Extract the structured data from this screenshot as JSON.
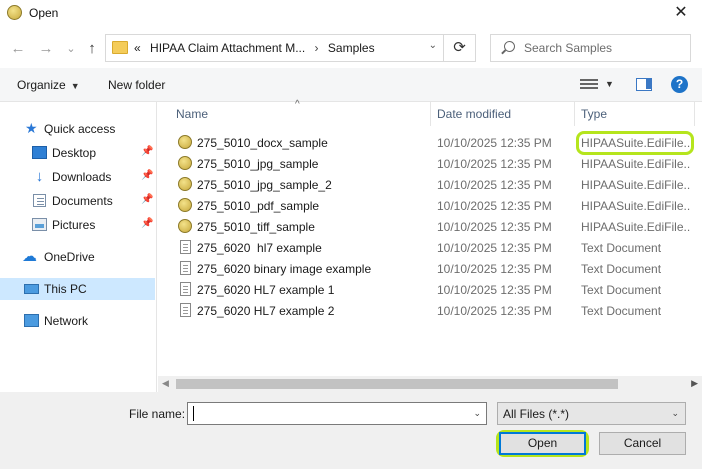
{
  "window": {
    "title": "Open",
    "close_glyph": "✕"
  },
  "nav": {
    "back_glyph": "←",
    "forward_glyph": "→",
    "recent_glyph": "⌄",
    "up_glyph": "↑",
    "refresh_glyph": "⟳"
  },
  "address": {
    "overflow": "«",
    "crumbs": [
      "HIPAA Claim Attachment M...",
      "Samples"
    ],
    "separator": "›",
    "dropdown_glyph": "⌄"
  },
  "search": {
    "placeholder": "Search Samples"
  },
  "toolbar": {
    "organize_label": "Organize",
    "organize_caret": "▼",
    "new_folder_label": "New folder",
    "view_caret": "▼",
    "help_label": "?"
  },
  "sidebar": {
    "pin_glyph": "📌",
    "items": [
      {
        "label": "Quick access",
        "icon": "star-icon",
        "glyph": "★"
      },
      {
        "label": "Desktop",
        "icon": "desktop-icon"
      },
      {
        "label": "Downloads",
        "icon": "downloads-icon",
        "glyph": "↓"
      },
      {
        "label": "Documents",
        "icon": "documents-icon"
      },
      {
        "label": "Pictures",
        "icon": "pictures-icon"
      },
      {
        "label": "OneDrive",
        "icon": "cloud-icon",
        "glyph": "☁"
      },
      {
        "label": "This PC",
        "icon": "computer-icon",
        "selected": true
      },
      {
        "label": "Network",
        "icon": "network-icon"
      }
    ]
  },
  "columns": {
    "name": "Name",
    "date": "Date modified",
    "type": "Type",
    "sort_glyph": "^"
  },
  "files": [
    {
      "name": "275_5010_docx_sample",
      "date": "10/10/2025 12:35 PM",
      "type": "HIPAASuite.EdiFile...",
      "icon": "edi-file-icon"
    },
    {
      "name": "275_5010_jpg_sample",
      "date": "10/10/2025 12:35 PM",
      "type": "HIPAASuite.EdiFile...",
      "icon": "edi-file-icon"
    },
    {
      "name": "275_5010_jpg_sample_2",
      "date": "10/10/2025 12:35 PM",
      "type": "HIPAASuite.EdiFile...",
      "icon": "edi-file-icon"
    },
    {
      "name": "275_5010_pdf_sample",
      "date": "10/10/2025 12:35 PM",
      "type": "HIPAASuite.EdiFile...",
      "icon": "edi-file-icon"
    },
    {
      "name": "275_5010_tiff_sample",
      "date": "10/10/2025 12:35 PM",
      "type": "HIPAASuite.EdiFile...",
      "icon": "edi-file-icon"
    },
    {
      "name": "275_6020  hl7 example",
      "date": "10/10/2025 12:35 PM",
      "type": "Text Document",
      "icon": "text-file-icon"
    },
    {
      "name": "275_6020 binary image example",
      "date": "10/10/2025 12:35 PM",
      "type": "Text Document",
      "icon": "text-file-icon"
    },
    {
      "name": "275_6020 HL7 example 1",
      "date": "10/10/2025 12:35 PM",
      "type": "Text Document",
      "icon": "text-file-icon"
    },
    {
      "name": "275_6020 HL7 example 2",
      "date": "10/10/2025 12:35 PM",
      "type": "Text Document",
      "icon": "text-file-icon"
    }
  ],
  "scrollbar": {
    "left_glyph": "◀",
    "right_glyph": "▶"
  },
  "footer": {
    "file_name_label": "File name:",
    "file_name_value": "",
    "dropdown_glyph": "⌄",
    "filter_value": "All Files (*.*)",
    "open_label": "Open",
    "cancel_label": "Cancel"
  },
  "colors": {
    "highlight": "#b5e51d",
    "selection": "#cde8ff",
    "accent": "#0078d7"
  }
}
